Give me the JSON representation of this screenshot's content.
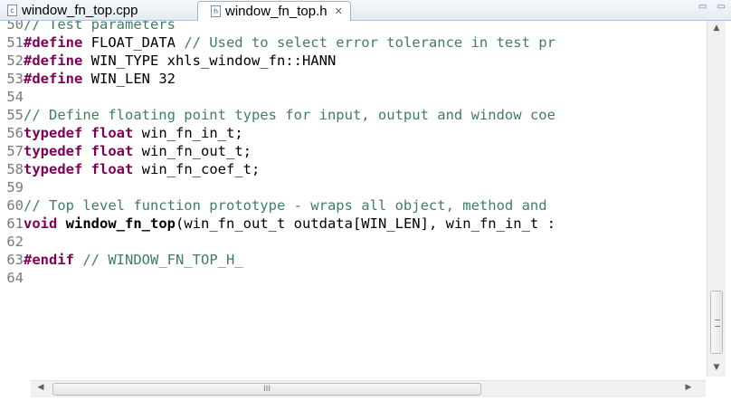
{
  "tabs": [
    {
      "label": "window_fn_top.cpp",
      "icon": "c-file-icon",
      "active": false
    },
    {
      "label": "window_fn_top.h",
      "icon": "h-file-icon",
      "active": true,
      "close_glyph": "✕"
    }
  ],
  "window_controls": "▭ ▭",
  "editor": {
    "lines": [
      {
        "n": "50",
        "parts": [
          [
            "cm",
            "// Test parameters"
          ]
        ]
      },
      {
        "n": "51",
        "parts": [
          [
            "kw",
            "#define"
          ],
          [
            "pl",
            " FLOAT_DATA "
          ],
          [
            "cm",
            "// Used to select error tolerance in test pr"
          ]
        ]
      },
      {
        "n": "52",
        "parts": [
          [
            "kw",
            "#define"
          ],
          [
            "pl",
            " WIN_TYPE xhls_window_fn::HANN"
          ]
        ]
      },
      {
        "n": "53",
        "parts": [
          [
            "kw",
            "#define"
          ],
          [
            "pl",
            " WIN_LEN 32"
          ]
        ]
      },
      {
        "n": "54",
        "parts": []
      },
      {
        "n": "55",
        "parts": [
          [
            "cm",
            "// Define floating point types for input, output and window coe"
          ]
        ]
      },
      {
        "n": "56",
        "parts": [
          [
            "kw",
            "typedef"
          ],
          [
            "pl",
            " "
          ],
          [
            "kw",
            "float"
          ],
          [
            "pl",
            " win_fn_in_t;"
          ]
        ]
      },
      {
        "n": "57",
        "parts": [
          [
            "kw",
            "typedef"
          ],
          [
            "pl",
            " "
          ],
          [
            "kw",
            "float"
          ],
          [
            "pl",
            " win_fn_out_t;"
          ]
        ]
      },
      {
        "n": "58",
        "parts": [
          [
            "kw",
            "typedef"
          ],
          [
            "pl",
            " "
          ],
          [
            "kw",
            "float"
          ],
          [
            "pl",
            " win_fn_coef_t;"
          ]
        ]
      },
      {
        "n": "59",
        "parts": []
      },
      {
        "n": "60",
        "parts": [
          [
            "cm",
            "// Top level function prototype - wraps all object, method and"
          ]
        ]
      },
      {
        "n": "61",
        "parts": [
          [
            "kw",
            "void"
          ],
          [
            "pl",
            " "
          ],
          [
            "fn",
            "window_fn_top"
          ],
          [
            "pl",
            "(win_fn_out_t outdata[WIN_LEN], win_fn_in_t :"
          ]
        ]
      },
      {
        "n": "62",
        "parts": []
      },
      {
        "n": "63",
        "parts": [
          [
            "kw",
            "#endif"
          ],
          [
            "pl",
            " "
          ],
          [
            "cm",
            "// WINDOW_FN_TOP_H_"
          ]
        ]
      },
      {
        "n": "64",
        "parts": []
      }
    ]
  },
  "scrollbars": {
    "up": "▲",
    "down": "▼",
    "left": "◀",
    "right": "▶",
    "grip": "III"
  }
}
